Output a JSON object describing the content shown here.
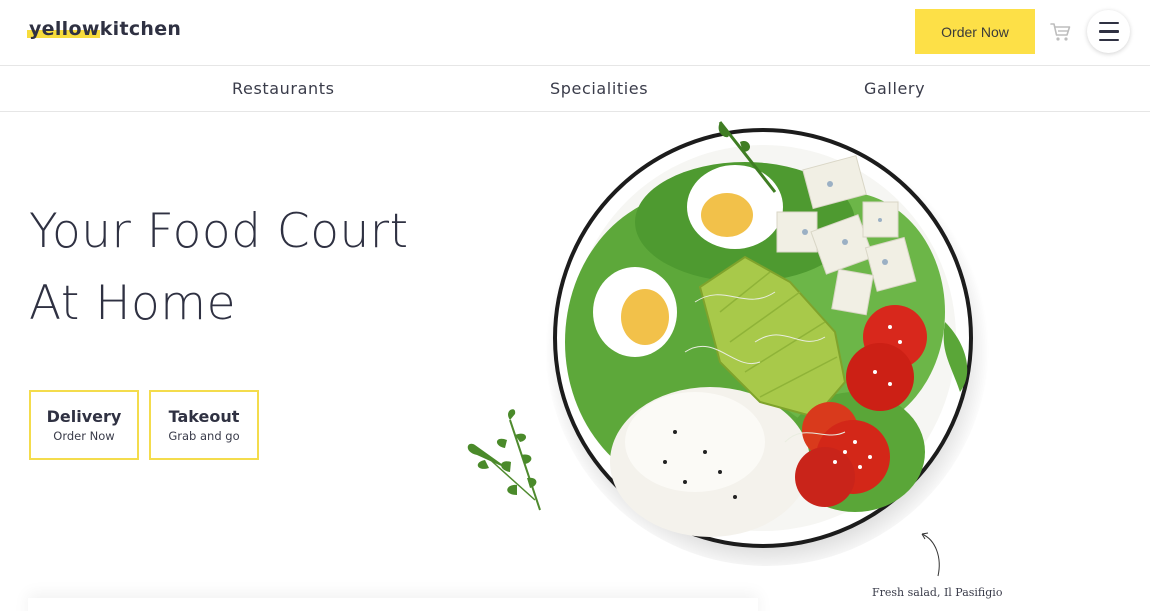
{
  "header": {
    "logo_highlight": "yellow",
    "logo_rest": "kitchen",
    "order_button": "Order Now",
    "cart_icon": "cart-icon",
    "menu_icon": "hamburger-menu-icon"
  },
  "nav": {
    "items": [
      "Restaurants",
      "Specialities",
      "Gallery"
    ]
  },
  "hero": {
    "title_line1": "Your Food Court",
    "title_line2": "At Home",
    "cards": [
      {
        "title": "Delivery",
        "subtitle": "Order Now"
      },
      {
        "title": "Takeout",
        "subtitle": "Grab and go"
      }
    ],
    "caption": "Fresh salad, Il Pasifigio"
  },
  "colors": {
    "accent": "#fde047",
    "text": "#2f3142",
    "border": "#f4dc4c"
  }
}
